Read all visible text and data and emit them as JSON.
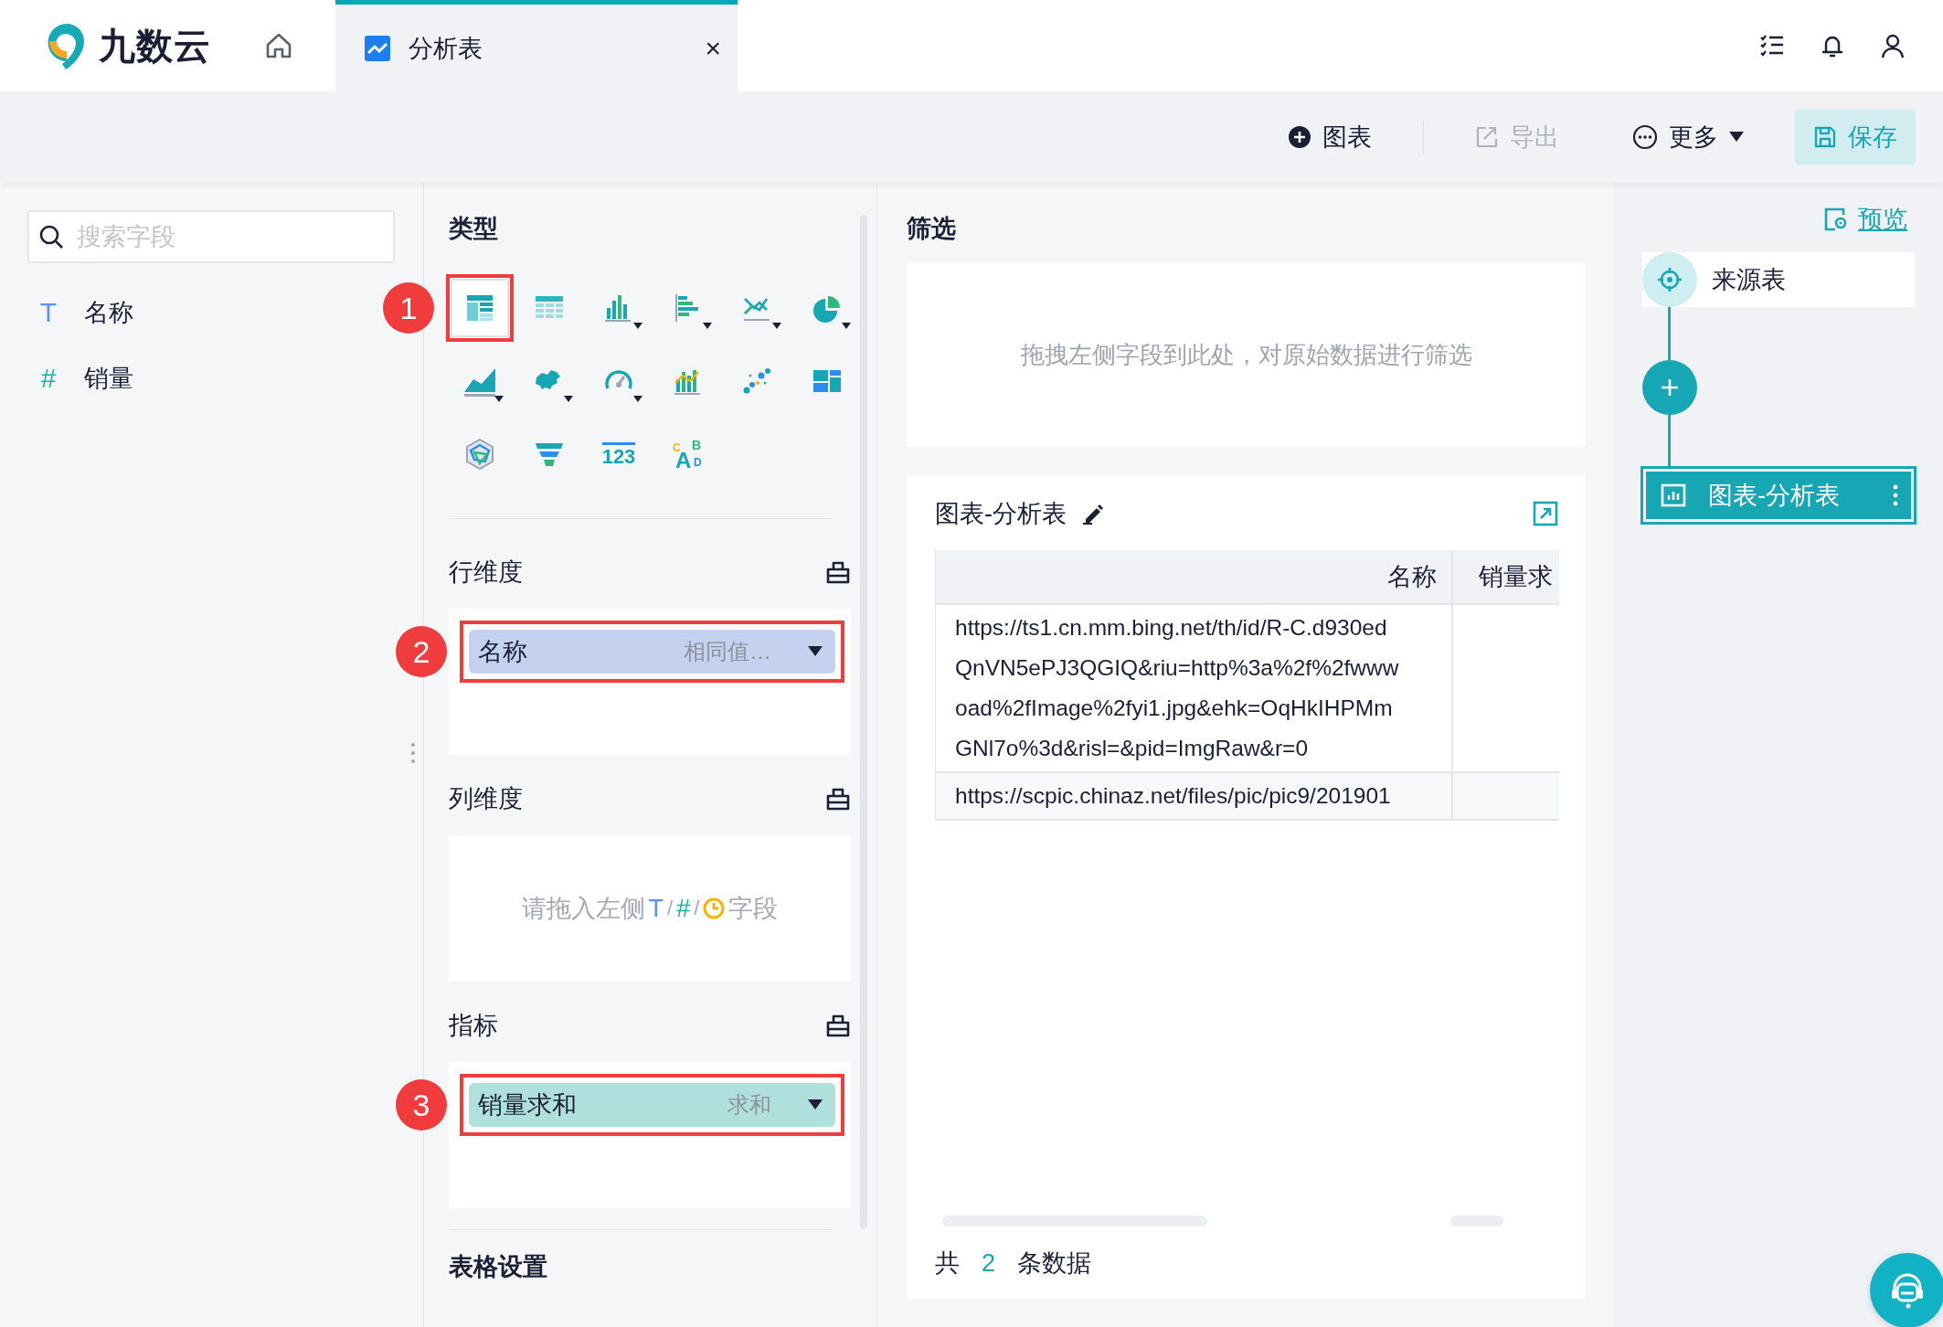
{
  "app": {
    "logo": "九数云"
  },
  "tabs": [
    {
      "label": "分析表",
      "selected": true,
      "close": "×"
    }
  ],
  "toolbar": [
    {
      "kind": "add",
      "label": "图表",
      "disabled": false
    },
    {
      "kind": "export",
      "label": "导出",
      "disabled": true
    },
    {
      "kind": "more",
      "label": "更多",
      "disabled": false
    },
    {
      "kind": "save",
      "label": "保存",
      "disabled": false
    }
  ],
  "field_search": {
    "placeholder": "搜索字段"
  },
  "fields": [
    {
      "kind": "text",
      "glyph": "T",
      "name": "名称"
    },
    {
      "kind": "number",
      "glyph": "#",
      "name": "销量"
    }
  ],
  "config": {
    "type_title": "类型",
    "chart_types": [
      {
        "kind": "table",
        "selected": true,
        "menu": false,
        "marker": "1"
      },
      {
        "kind": "crosstab",
        "selected": false,
        "menu": false
      },
      {
        "kind": "bar",
        "selected": false,
        "menu": true
      },
      {
        "kind": "hbar",
        "selected": false,
        "menu": true
      },
      {
        "kind": "line",
        "selected": false,
        "menu": true
      },
      {
        "kind": "pie",
        "selected": false,
        "menu": true
      },
      {
        "kind": "area",
        "selected": false,
        "menu": true
      },
      {
        "kind": "map",
        "selected": false,
        "menu": true
      },
      {
        "kind": "gauge",
        "selected": false,
        "menu": true
      },
      {
        "kind": "combo",
        "selected": false,
        "menu": false
      },
      {
        "kind": "scatter",
        "selected": false,
        "menu": false
      },
      {
        "kind": "tiles",
        "selected": false,
        "menu": false
      },
      {
        "kind": "radar",
        "selected": false,
        "menu": false
      },
      {
        "kind": "funnel",
        "selected": false,
        "menu": false
      },
      {
        "kind": "number",
        "selected": false,
        "menu": false,
        "label": "123"
      },
      {
        "kind": "wordcloud",
        "selected": false,
        "menu": false,
        "letters": [
          "C",
          "A",
          "B",
          "D"
        ]
      }
    ],
    "sections": [
      {
        "title": "行维度",
        "items": [
          {
            "kind": "dimension",
            "name": "名称",
            "hint": "相同值…",
            "marker": "2"
          }
        ]
      },
      {
        "title": "列维度",
        "placeholder": [
          {
            "kind": "text",
            "text": "请拖入左侧"
          },
          {
            "kind": "type",
            "text": "T",
            "color": "#5b8ff9"
          },
          {
            "kind": "sep",
            "text": "/"
          },
          {
            "kind": "type",
            "text": "#",
            "color": "#16b3a5"
          },
          {
            "kind": "sep",
            "text": "/"
          },
          {
            "kind": "clock"
          },
          {
            "kind": "text",
            "text": "字段"
          }
        ]
      },
      {
        "title": "指标",
        "items": [
          {
            "kind": "measure",
            "name": "销量求和",
            "hint": "求和",
            "marker": "3"
          }
        ]
      }
    ],
    "table_settings_title": "表格设置"
  },
  "filter": {
    "title": "筛选",
    "placeholder": "拖拽左侧字段到此处，对原始数据进行筛选"
  },
  "chart": {
    "title": "图表-分析表",
    "columns": [
      "名称",
      "销量求"
    ],
    "rows": [
      {
        "cells": [
          [
            "https://ts1.cn.mm.bing.net/th/id/R-C.d930ed",
            "QnVN5ePJ3QGIQ&riu=http%3a%2f%2fwww",
            "oad%2fImage%2fyi1.jpg&ehk=OqHkIHPMm",
            "GNl7o%3d&risl=&pid=ImgRaw&r=0"
          ]
        ]
      },
      {
        "cells": [
          [
            "https://scpic.chinaz.net/files/pic/pic9/201901"
          ]
        ]
      }
    ],
    "footer": {
      "prefix": "共",
      "count": "2",
      "suffix": "条数据"
    }
  },
  "flow": {
    "preview": "预览",
    "nodes": [
      {
        "kind": "source",
        "label": "来源表",
        "selected": false
      },
      {
        "kind": "add"
      },
      {
        "kind": "chart",
        "label": "图表-分析表",
        "selected": true
      }
    ]
  }
}
